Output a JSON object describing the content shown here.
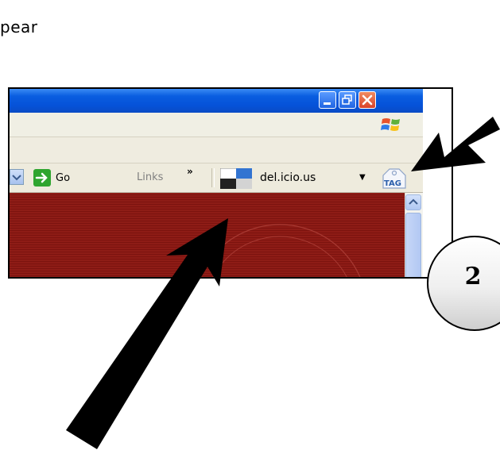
{
  "caption": "pear",
  "window": {
    "toolbar": {
      "go_label": "Go",
      "links_label": "Links",
      "more_chevron": "»",
      "bookmark_label": "del.icio.us",
      "bookmark_caret": "▼",
      "tag_label": "TAG"
    },
    "icons": {
      "minimize": "minimize-icon",
      "restore": "restore-icon",
      "close": "close-icon",
      "windows_logo": "windows-logo-icon",
      "go": "go-arrow-icon",
      "delicious": "delicious-logo-icon",
      "tag": "tag-icon",
      "scroll_up": "chevron-up-icon"
    }
  },
  "callout": {
    "number": "2"
  },
  "colors": {
    "titlebar": "#0552d8",
    "content_bg": "#8e1c16",
    "callout_bg": "#efefef"
  }
}
